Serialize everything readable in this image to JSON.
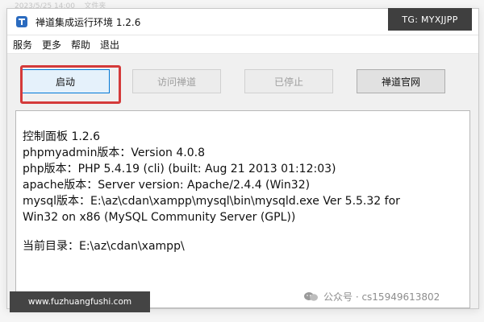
{
  "window": {
    "title": "禅道集成运行环境 1.2.6",
    "controls": {
      "minimize": "—",
      "maximize": "□",
      "close": "✕"
    }
  },
  "menu": {
    "items": [
      {
        "label": "服务"
      },
      {
        "label": "更多"
      },
      {
        "label": "帮助"
      },
      {
        "label": "退出"
      }
    ]
  },
  "toolbar": {
    "start_label": "启动",
    "visit_label": "访问禅道",
    "stopped_label": "已停止",
    "website_label": "禅道官网"
  },
  "console": {
    "lines": [
      "控制面板 1.2.6",
      "phpmyadmin版本：Version 4.0.8",
      "php版本：PHP 5.4.19 (cli) (built: Aug 21 2013 01:12:03)",
      "apache版本：Server version: Apache/2.4.4 (Win32)",
      "mysql版本：E:\\az\\cdan\\xampp\\mysql\\bin\\mysqld.exe  Ver 5.5.32 for",
      "Win32 on x86 (MySQL Community Server (GPL))",
      "",
      "当前目录：E:\\az\\cdan\\xampp\\"
    ]
  },
  "watermarks": {
    "top_right": "TG: MYXJJPP",
    "bottom_left": "www.fuzhuangfushi.com",
    "bottom_right": "公众号 · cs15949613802"
  },
  "colors": {
    "highlight_box": "#d43a3a",
    "button_border": "#adadad",
    "disabled_text": "#9e9e9e"
  },
  "icons": {
    "app_icon": "chandao-app-icon",
    "wechat_icon": "wechat-icon"
  }
}
